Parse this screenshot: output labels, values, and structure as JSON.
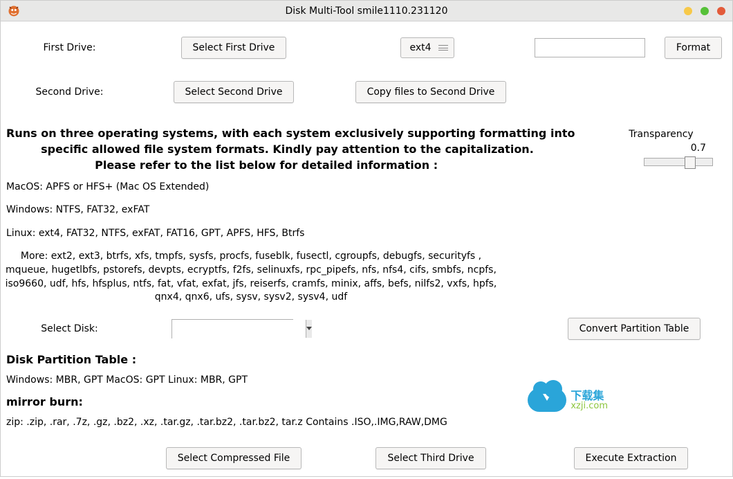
{
  "window": {
    "title": "Disk Multi-Tool smile1110.231120"
  },
  "row1": {
    "label": "First Drive:",
    "select_btn": "Select First Drive",
    "fs_selected": "ext4",
    "path_value": "",
    "format_btn": "Format"
  },
  "row2": {
    "label": "Second Drive:",
    "select_btn": "Select Second Drive",
    "copy_btn": "Copy files to Second Drive"
  },
  "intro": {
    "l1": "Runs on three operating systems, with each system exclusively supporting formatting into",
    "l2": "         specific allowed file system formats. Kindly pay attention to the capitalization.",
    "l3": "                       Please refer to the list below for detailed information :"
  },
  "os": {
    "mac": "MacOS: APFS or HFS+ (Mac OS Extended)",
    "win": "Windows: NTFS, FAT32, exFAT",
    "linux": "Linux: ext4, FAT32, NTFS, exFAT, FAT16, GPT, APFS, HFS, Btrfs"
  },
  "more": "More: ext2, ext3, btrfs, xfs, tmpfs, sysfs, procfs, fuseblk, fusectl, cgroupfs, debugfs, securityfs , mqueue, hugetlbfs, pstorefs, devpts, ecryptfs, f2fs, selinuxfs, rpc_pipefs, nfs, nfs4, cifs, smbfs, ncpfs, iso9660, udf, hfs, hfsplus, ntfs, fat, vfat, exfat, jfs, reiserfs, cramfs, minix, affs, befs, nilfs2, vxfs, hpfs, qnx4, qnx6, ufs, sysv, sysv2, sysv4, udf",
  "transparency": {
    "label": "Transparency",
    "value": "0.7"
  },
  "selectdisk": {
    "label": "Select Disk:",
    "value": "",
    "convert_btn": "Convert Partition Table"
  },
  "partition": {
    "header": "Disk Partition Table :",
    "detail": "Windows: MBR, GPT    MacOS: GPT    Linux: MBR, GPT"
  },
  "mirror": {
    "header": "mirror burn:",
    "detail": "zip: .zip, .rar, .7z, .gz, .bz2, .xz, .tar.gz, .tar.bz2, .tar.bz2, tar.z Contains .ISO,.IMG,RAW,DMG"
  },
  "bottom": {
    "compressed_btn": "Select Compressed File",
    "third_btn": "Select Third Drive",
    "exec_btn": "Execute Extraction"
  },
  "logo": {
    "line1": "下载集",
    "line2": "xzji.com"
  }
}
